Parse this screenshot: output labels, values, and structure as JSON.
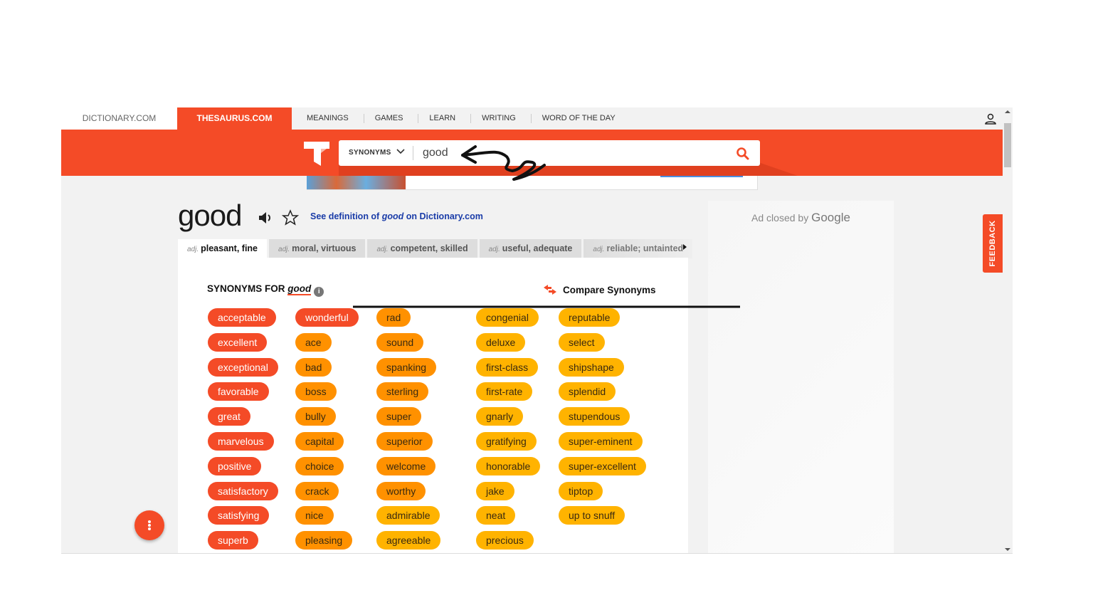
{
  "nav": {
    "dictionary": "DICTIONARY.COM",
    "thesaurus": "THESAURUS.COM",
    "links": [
      "MEANINGS",
      "GAMES",
      "LEARN",
      "WRITING",
      "WORD OF THE DAY"
    ]
  },
  "search": {
    "mode": "SYNONYMS",
    "value": "good"
  },
  "entry": {
    "word": "good",
    "def_prefix": "See definition of ",
    "def_word": "good",
    "def_suffix": " on Dictionary.com"
  },
  "tabs": [
    {
      "pos": "adj.",
      "label": "pleasant, fine",
      "active": true
    },
    {
      "pos": "adj.",
      "label": "moral, virtuous"
    },
    {
      "pos": "adj.",
      "label": "competent, skilled"
    },
    {
      "pos": "adj.",
      "label": "useful, adequate"
    },
    {
      "pos": "adj.",
      "label": "reliable; untainted"
    }
  ],
  "synonyms_header": {
    "prefix": "SYNONYMS FOR ",
    "word": "good",
    "info": "i",
    "compare": "Compare Synonyms"
  },
  "colors": {
    "brand": "#f44b27",
    "tier1": "#f44b27",
    "tier2": "#ff9100",
    "tier3": "#ffb300"
  },
  "synonym_columns": [
    [
      [
        "acceptable",
        1
      ],
      [
        "excellent",
        1
      ],
      [
        "exceptional",
        1
      ],
      [
        "favorable",
        1
      ],
      [
        "great",
        1
      ],
      [
        "marvelous",
        1
      ],
      [
        "positive",
        1
      ],
      [
        "satisfactory",
        1
      ],
      [
        "satisfying",
        1
      ],
      [
        "superb",
        1
      ]
    ],
    [
      [
        "wonderful",
        1
      ],
      [
        "ace",
        2
      ],
      [
        "bad",
        2
      ],
      [
        "boss",
        2
      ],
      [
        "bully",
        2
      ],
      [
        "capital",
        2
      ],
      [
        "choice",
        2
      ],
      [
        "crack",
        2
      ],
      [
        "nice",
        2
      ],
      [
        "pleasing",
        2
      ]
    ],
    [
      [
        "rad",
        2
      ],
      [
        "sound",
        2
      ],
      [
        "spanking",
        2
      ],
      [
        "sterling",
        2
      ],
      [
        "super",
        2
      ],
      [
        "superior",
        2
      ],
      [
        "welcome",
        2
      ],
      [
        "worthy",
        2
      ],
      [
        "admirable",
        3
      ],
      [
        "agreeable",
        3
      ]
    ],
    [
      [
        "congenial",
        3
      ],
      [
        "deluxe",
        3
      ],
      [
        "first-class",
        3
      ],
      [
        "first-rate",
        3
      ],
      [
        "gnarly",
        3
      ],
      [
        "gratifying",
        3
      ],
      [
        "honorable",
        3
      ],
      [
        "jake",
        3
      ],
      [
        "neat",
        3
      ],
      [
        "precious",
        3
      ]
    ],
    [
      [
        "reputable",
        3
      ],
      [
        "select",
        3
      ],
      [
        "shipshape",
        3
      ],
      [
        "splendid",
        3
      ],
      [
        "stupendous",
        3
      ],
      [
        "super-eminent",
        3
      ],
      [
        "super-excellent",
        3
      ],
      [
        "tiptop",
        3
      ],
      [
        "up to snuff",
        3
      ]
    ]
  ],
  "ad": {
    "text": "Ad closed by ",
    "brand": "Google"
  },
  "feedback": "FEEDBACK",
  "icons": {
    "user": "user-icon",
    "search": "search-icon",
    "speaker": "speaker-icon",
    "star": "star-icon",
    "compare": "compare-arrows-icon",
    "more": "more-vertical-icon"
  }
}
